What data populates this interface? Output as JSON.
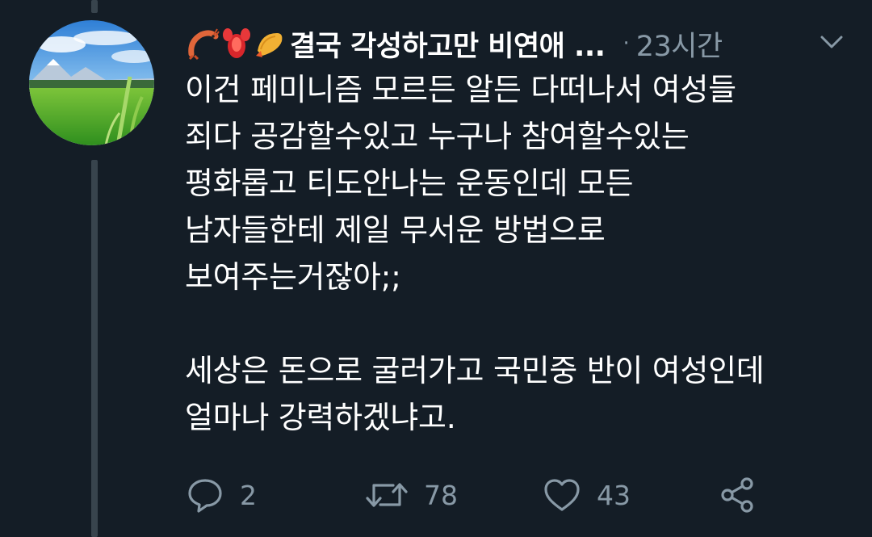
{
  "tweet": {
    "emojis": [
      "shrimp-emoji",
      "lobster-emoji",
      "fried-shrimp-emoji"
    ],
    "display_name": "결국 각성하고만 비연애 ...",
    "separator": "·",
    "timestamp": "23시간",
    "text_lines": [
      "이건 페미니즘 모르든 알든 다떠나서 여성들",
      "죄다 공감할수있고 누구나 참여할수있는",
      "평화롭고 티도안나는 운동인데 모든",
      "남자들한테 제일 무서운 방법으로",
      "보여주는거잖아;;",
      "",
      "세상은 돈으로 굴러가고 국민중 반이 여성인데",
      "얼마나 강력하겠냐고."
    ],
    "actions": {
      "reply_count": "2",
      "retweet_count": "78",
      "like_count": "43"
    }
  },
  "colors": {
    "background": "#141d26",
    "text": "#ffffff",
    "secondary": "#8899a6",
    "thread_line": "#38444d"
  }
}
